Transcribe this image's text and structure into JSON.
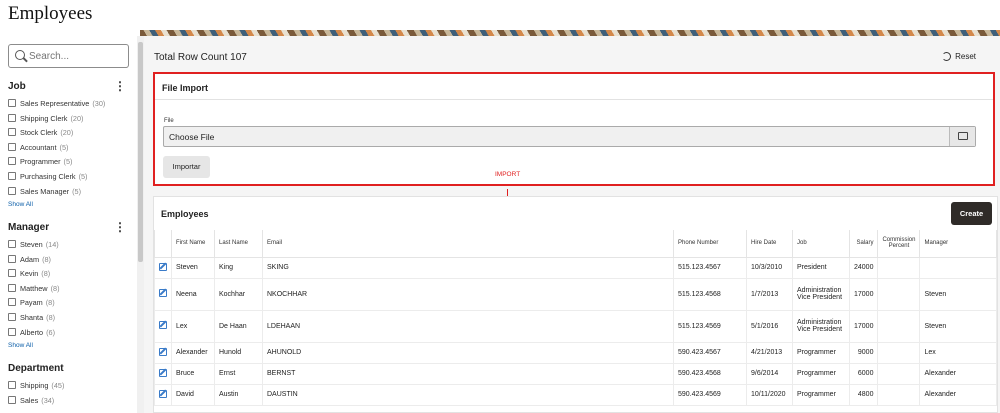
{
  "app": {
    "title": "Employees"
  },
  "search": {
    "placeholder": "Search..."
  },
  "facets": [
    {
      "title": "Job",
      "options": [
        {
          "label": "Sales Representative",
          "count": "(30)"
        },
        {
          "label": "Shipping Clerk",
          "count": "(20)"
        },
        {
          "label": "Stock Clerk",
          "count": "(20)"
        },
        {
          "label": "Accountant",
          "count": "(5)"
        },
        {
          "label": "Programmer",
          "count": "(5)"
        },
        {
          "label": "Purchasing Clerk",
          "count": "(5)"
        },
        {
          "label": "Sales Manager",
          "count": "(5)"
        }
      ],
      "show_all": "Show All"
    },
    {
      "title": "Manager",
      "options": [
        {
          "label": "Steven",
          "count": "(14)"
        },
        {
          "label": "Adam",
          "count": "(8)"
        },
        {
          "label": "Kevin",
          "count": "(8)"
        },
        {
          "label": "Matthew",
          "count": "(8)"
        },
        {
          "label": "Payam",
          "count": "(8)"
        },
        {
          "label": "Shanta",
          "count": "(8)"
        },
        {
          "label": "Alberto",
          "count": "(6)"
        }
      ],
      "show_all": "Show All"
    },
    {
      "title": "Department",
      "options": [
        {
          "label": "Shipping",
          "count": "(45)"
        },
        {
          "label": "Sales",
          "count": "(34)"
        }
      ]
    }
  ],
  "main": {
    "total_row_count": "Total Row Count 107",
    "reset_label": "Reset"
  },
  "file_import": {
    "title": "File Import",
    "file_label": "File",
    "file_value": "Choose File",
    "import_button": "Importar",
    "annotation": "IMPORT"
  },
  "employees": {
    "title": "Employees",
    "create_label": "Create",
    "columns": [
      "First Name",
      "Last Name",
      "Email",
      "Phone Number",
      "Hire Date",
      "Job",
      "Salary",
      "Commission Percent",
      "Manager"
    ],
    "rows": [
      [
        "Steven",
        "King",
        "SKING",
        "515.123.4567",
        "10/3/2010",
        "President",
        "24000",
        "",
        ""
      ],
      [
        "Neena",
        "Kochhar",
        "NKOCHHAR",
        "515.123.4568",
        "1/7/2013",
        "Administration Vice President",
        "17000",
        "",
        "Steven"
      ],
      [
        "Lex",
        "De Haan",
        "LDEHAAN",
        "515.123.4569",
        "5/1/2016",
        "Administration Vice President",
        "17000",
        "",
        "Steven"
      ],
      [
        "Alexander",
        "Hunold",
        "AHUNOLD",
        "590.423.4567",
        "4/21/2013",
        "Programmer",
        "9000",
        "",
        "Lex"
      ],
      [
        "Bruce",
        "Ernst",
        "BERNST",
        "590.423.4568",
        "9/6/2014",
        "Programmer",
        "6000",
        "",
        "Alexander"
      ],
      [
        "David",
        "Austin",
        "DAUSTIN",
        "590.423.4569",
        "10/11/2020",
        "Programmer",
        "4800",
        "",
        "Alexander"
      ]
    ]
  }
}
